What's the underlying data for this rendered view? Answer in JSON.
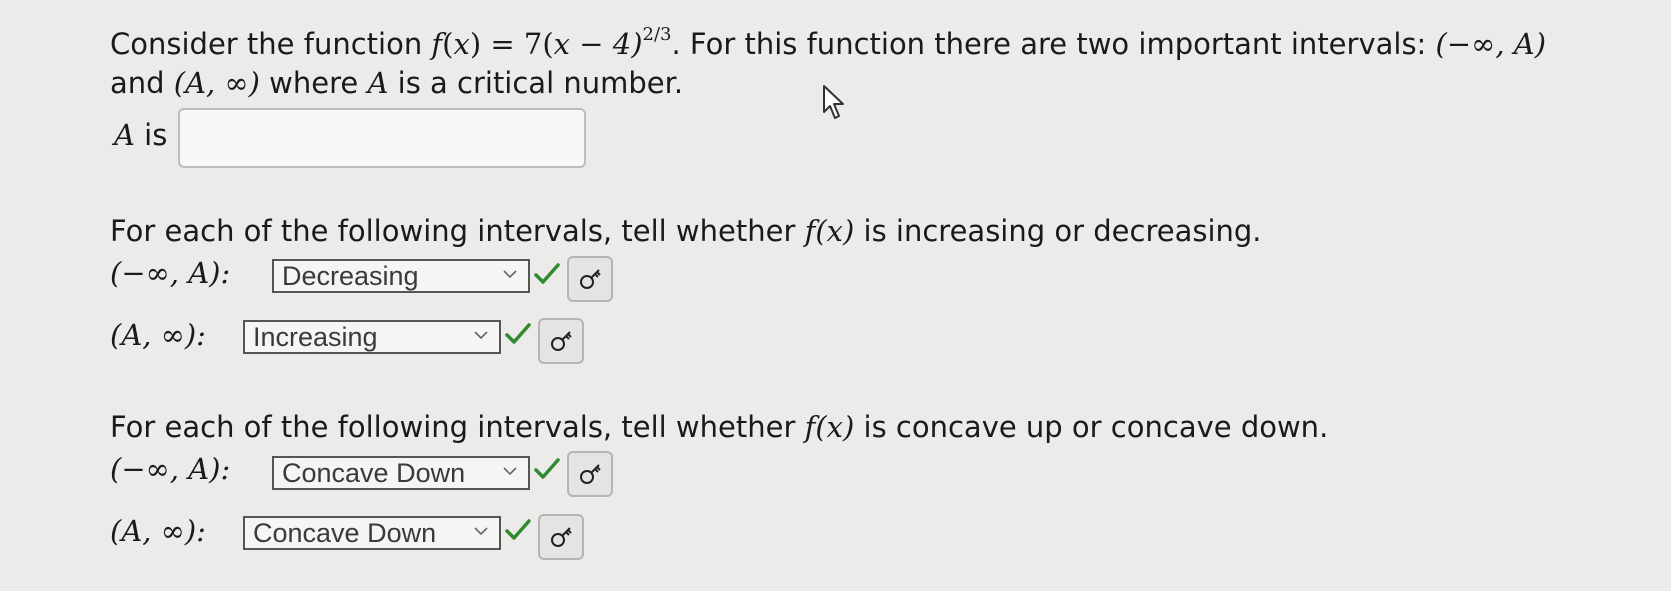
{
  "intro": {
    "text1": "Consider the function ",
    "func_lhs": "f",
    "func_x": "x",
    "eq": " = 7(",
    "func_arg": "x − 4)",
    "exponent": "2/3",
    "text2": ". For this function there are two important intervals: ",
    "interval_left": "(−∞, A)",
    "line2_and": "and ",
    "interval_right": "(A, ∞)",
    "line2_rest": " where ",
    "A": "A",
    "line2_end": " is a critical number."
  },
  "answer": {
    "label_var": "A",
    "label_is": " is",
    "value": ""
  },
  "increasing_section": {
    "prompt_start": "For each of the following intervals, tell whether ",
    "fx": "f(x)",
    "prompt_end": " is increasing or decreasing.",
    "rows": [
      {
        "interval": "(−∞, A):",
        "selected": "Decreasing"
      },
      {
        "interval": "(A, ∞):",
        "selected": "Increasing"
      }
    ]
  },
  "concavity_section": {
    "prompt_start": "For each of the following intervals, tell whether ",
    "fx": "f(x)",
    "prompt_end": " is concave up or concave down.",
    "rows": [
      {
        "interval": "(−∞, A):",
        "selected": "Concave Down"
      },
      {
        "interval": "(A, ∞):",
        "selected": "Concave Down"
      }
    ]
  },
  "icons": {
    "check": "check-icon",
    "key": "key-icon",
    "chevron": "chevron-down-icon",
    "cursor": "mouse-pointer-icon"
  },
  "colors": {
    "check": "#2e8b2e",
    "background": "#ecebe9"
  }
}
